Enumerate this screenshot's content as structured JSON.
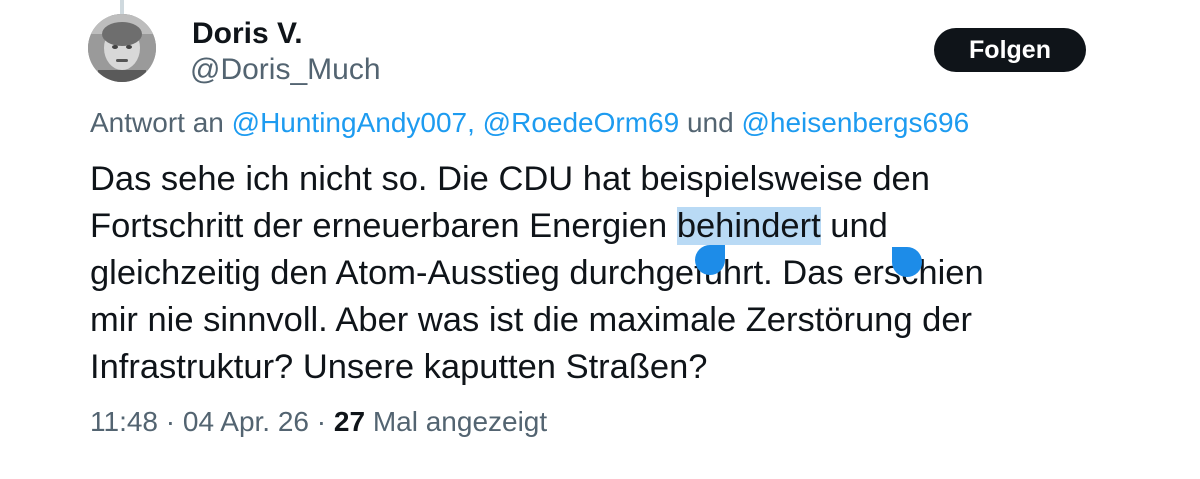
{
  "author": {
    "display_name": "Doris V.",
    "handle": "@Doris_Much"
  },
  "follow_button": {
    "label": "Folgen"
  },
  "reply_context": {
    "prefix": "Antwort an",
    "mention_1": "@HuntingAndy007,",
    "mention_2": "@RoedeOrm69",
    "joiner": "und",
    "mention_3": "@heisenbergs696"
  },
  "tweet": {
    "line_1": "Das sehe ich nicht so. Die CDU hat beispielsweise den",
    "line_2_before": "Fortschritt der erneuerbaren Energien ",
    "line_2_selected": "behindert",
    "line_2_after": " und",
    "line_3": "gleichzeitig den Atom-Ausstieg durchgeführt. Das erschien",
    "line_4": "mir nie sinnvoll. Aber was ist die maximale Zerstörung der",
    "line_5": "Infrastruktur? Unsere kaputten Straßen?"
  },
  "meta": {
    "time": "11:48",
    "separator": "·",
    "date": "04 Apr. 26",
    "views_count": "27",
    "views_label": "Mal angezeigt"
  },
  "colors": {
    "accent": "#1d9bf0",
    "selection": "#b9daf5",
    "secondary_text": "#536471",
    "primary_text": "#0f1419"
  }
}
